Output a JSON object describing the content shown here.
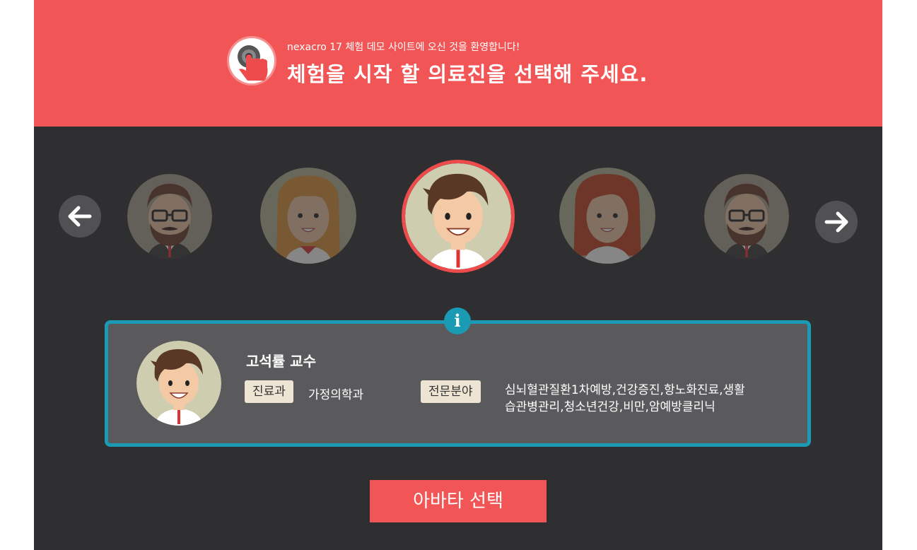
{
  "header": {
    "welcome": "nexacro 17 체험 데모 사이트에 오신 것을 환영합니다!",
    "headline": "체험을 시작 할 의료진을 선택해 주세요."
  },
  "carousel": {
    "avatars": [
      "bearded-doctor",
      "female-doctor-blonde",
      "male-doctor-selected",
      "female-doctor-brown",
      "bearded-doctor"
    ],
    "selected_index": 2
  },
  "info": {
    "name": "고석률 교수",
    "dept_label": "진료과",
    "dept_value": "가정의학과",
    "spec_label": "전문분야",
    "spec_line1": "심뇌혈관질환1차예방,건강증진,항노화진료,생활",
    "spec_line2": "습관병관리,청소년건강,비만,암예방클리닉"
  },
  "select_button": "아바타 선택",
  "colors": {
    "header_bg": "#f15555",
    "body_bg": "#2f2e30",
    "accent": "#1a9ab3",
    "button": "#f15555"
  }
}
